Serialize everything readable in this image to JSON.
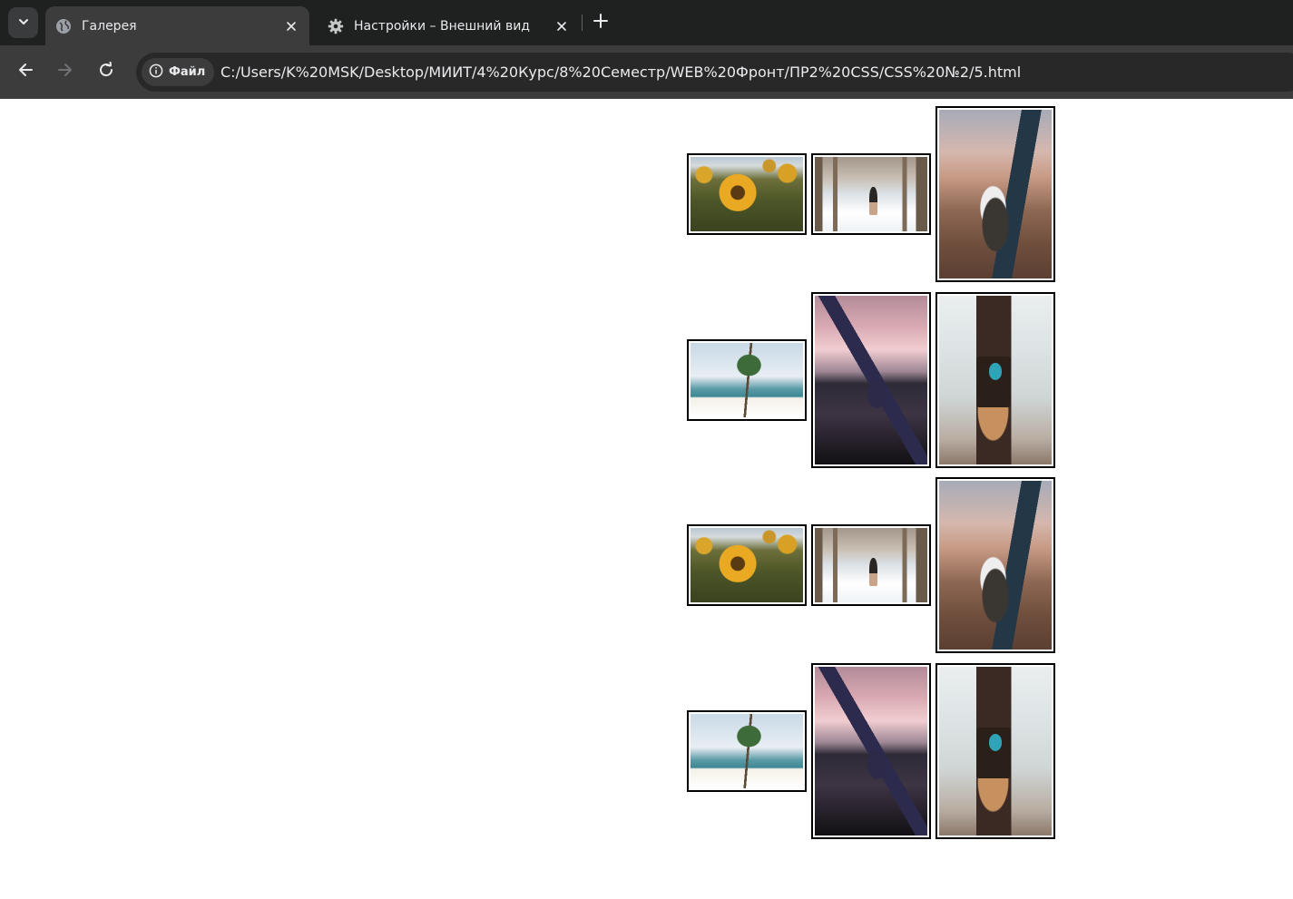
{
  "browser": {
    "tabs": [
      {
        "title": "Галерея",
        "icon": "globe-icon",
        "active": true
      },
      {
        "title": "Настройки – Внешний вид",
        "icon": "gear-icon",
        "active": false
      }
    ],
    "security_chip": "Файл",
    "url": "C:/Users/K%20MSK/Desktop/МИИТ/4%20Курс/8%20Семестр/WEB%20Фронт/ПР2%20CSS/CSS%20№2/5.html"
  },
  "gallery": {
    "photos": [
      {
        "subject": "sunflower"
      },
      {
        "subject": "girl under pier"
      },
      {
        "subject": "skateboard"
      },
      {
        "subject": "palm tree on beach"
      },
      {
        "subject": "surfer at sunset"
      },
      {
        "subject": "coconut drink cup"
      },
      {
        "subject": "sunflower"
      },
      {
        "subject": "girl under pier"
      },
      {
        "subject": "skateboard"
      },
      {
        "subject": "palm tree on beach"
      },
      {
        "subject": "surfer at sunset"
      },
      {
        "subject": "coconut drink cup"
      }
    ]
  },
  "colors": {
    "tabstrip": "#1f2020",
    "toolbar": "#3c3c3c",
    "omnibox": "#282828",
    "text": "#e8eaed",
    "photo_border": "#000000"
  }
}
